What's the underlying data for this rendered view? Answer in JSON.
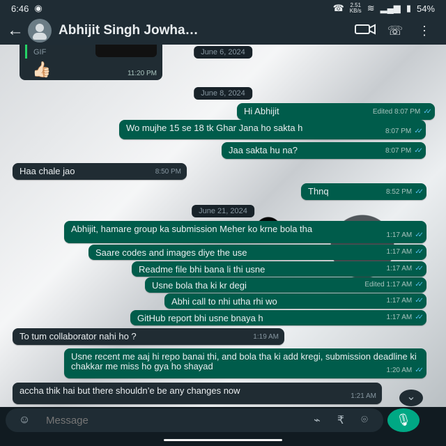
{
  "status": {
    "time": "6:46",
    "network_speed": "2.51",
    "network_unit": "KB/s",
    "battery": "54%",
    "icons": [
      "screen-record-icon",
      "phone-icon",
      "wifi-icon",
      "signal-icon",
      "battery-icon"
    ]
  },
  "header": {
    "contact_name": "Abhijit Singh Jowha…",
    "icons": [
      "back-arrow-icon",
      "avatar-icon",
      "video-call-icon",
      "voice-call-icon",
      "more-options-icon"
    ]
  },
  "chat": {
    "top_gif": {
      "label": "GIF",
      "emoji": "👍🏻",
      "time": "11:20 PM"
    },
    "dates": [
      "June 6, 2024",
      "June 8, 2024",
      "June 21, 2024"
    ],
    "messages": [
      {
        "side": "sent",
        "text": "Hi Abhijit",
        "edited": "Edited",
        "time": "8:07 PM"
      },
      {
        "side": "sent",
        "text": "Wo mujhe 15 se 18 tk Ghar Jana ho sakta h",
        "edited": "",
        "time": "8:07 PM"
      },
      {
        "side": "sent",
        "text": "Jaa sakta hu na?",
        "edited": "",
        "time": "8:07 PM"
      },
      {
        "side": "recv",
        "text": "Haa chale jao",
        "edited": "",
        "time": "8:50 PM"
      },
      {
        "side": "sent",
        "text": "Thnq",
        "edited": "",
        "time": "8:52 PM"
      },
      {
        "side": "sent",
        "text": "Abhijit, hamare group ka submission Meher ko krne bola tha",
        "edited": "",
        "time": "1:17 AM"
      },
      {
        "side": "sent",
        "text": "Saare codes and images diye the use",
        "edited": "",
        "time": "1:17 AM"
      },
      {
        "side": "sent",
        "text": "Readme file bhi bana li thi usne",
        "edited": "",
        "time": "1:17 AM"
      },
      {
        "side": "sent",
        "text": "Usne bola tha ki kr degi",
        "edited": "Edited",
        "time": "1:17 AM"
      },
      {
        "side": "sent",
        "text": "Abhi call to nhi utha rhi wo",
        "edited": "",
        "time": "1:17 AM"
      },
      {
        "side": "sent",
        "text": "GitHub report bhi usne bnaya h",
        "edited": "",
        "time": "1:17 AM"
      },
      {
        "side": "recv",
        "text": "To tum collaborator nahi ho ?",
        "edited": "",
        "time": "1:19 AM"
      },
      {
        "side": "sent",
        "text": "Usne recent me aaj hi repo banai thi, and bola tha ki add kregi, submission deadline ki chakkar me miss ho gya ho shayad",
        "edited": "",
        "time": "1:20 AM"
      },
      {
        "side": "recv",
        "text": "accha thik hai but there shouldn’e be any changes now",
        "edited": "",
        "time": "1:21 AM"
      }
    ]
  },
  "composer": {
    "placeholder": "Message",
    "icons": [
      "emoji-icon",
      "attach-icon",
      "rupee-payment-icon",
      "camera-icon",
      "mic-icon",
      "scroll-down-icon"
    ]
  },
  "colors": {
    "sent_bubble": "#005c4b",
    "received_bubble": "#202c33",
    "accent": "#00a884",
    "read_ticks": "#53bdeb"
  }
}
